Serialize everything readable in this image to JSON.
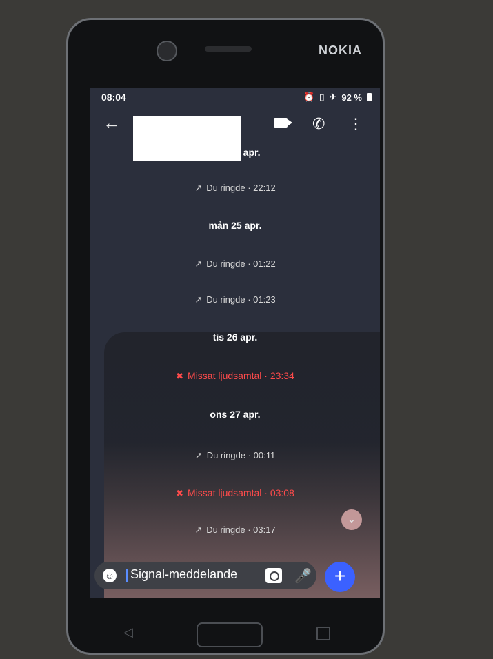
{
  "device": {
    "brand": "NOKIA"
  },
  "status_bar": {
    "time": "08:04",
    "alarm_icon": "alarm-icon",
    "vibrate_icon": "vibrate-icon",
    "airplane_icon": "airplane-icon",
    "battery": "92 %"
  },
  "app_bar": {
    "back_glyph": "←",
    "phone_glyph": "✆",
    "more_glyph": "⋮"
  },
  "conversation": {
    "items": [
      {
        "date": "sön 24 apr."
      },
      {
        "call": "Du ringde · 22:12",
        "missed": false
      },
      {
        "date": "mån 25 apr."
      },
      {
        "call": "Du ringde · 01:22",
        "missed": false
      },
      {
        "call": "Du ringde · 01:23",
        "missed": false
      },
      {
        "date": "tis 26 apr."
      },
      {
        "call": "Missat ljudsamtal · 23:34",
        "missed": true
      },
      {
        "date": "ons 27 apr."
      },
      {
        "call": "Du ringde · 00:11",
        "missed": false
      },
      {
        "call": "Missat ljudsamtal · 03:08",
        "missed": true
      },
      {
        "call": "Du ringde · 03:17",
        "missed": false
      }
    ]
  },
  "composer": {
    "placeholder": "Signal-meddelande"
  },
  "colors": {
    "accent": "#3b61ff",
    "missed": "#ff4b4b",
    "background": "#2b2f3c"
  }
}
